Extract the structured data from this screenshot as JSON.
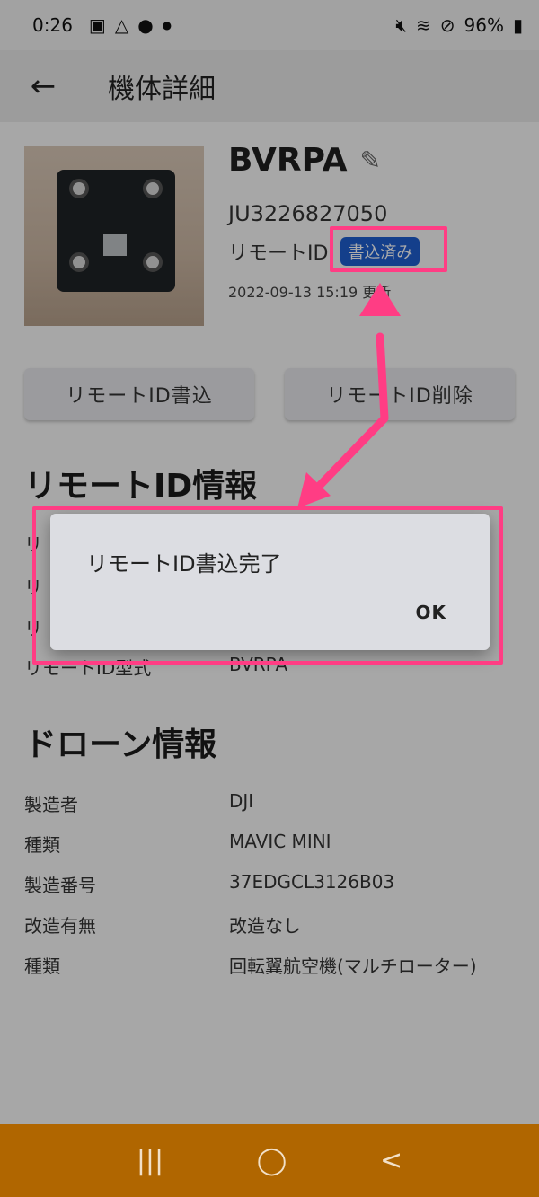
{
  "status_bar": {
    "time": "0:26",
    "battery": "96%",
    "icons_left": [
      "image-icon",
      "drive-icon",
      "account-icon",
      "dot-icon"
    ],
    "icons_right": [
      "mute-icon",
      "wifi-icon",
      "dnd-icon",
      "battery-icon"
    ]
  },
  "app_bar": {
    "title": "機体詳細",
    "back_icon": "arrow-left-icon"
  },
  "aircraft": {
    "name": "BVRPA",
    "serial": "JU3226827050",
    "remote_id_label": "リモートID",
    "remote_id_status": "書込済み",
    "updated": "2022-09-13 15:19 更新"
  },
  "buttons": {
    "write": "リモートID書込",
    "delete": "リモートID削除"
  },
  "remote_id_section": {
    "title": "リモートID情報",
    "rows": [
      {
        "key": "リモートID型式",
        "value": "BVRPA"
      }
    ]
  },
  "drone_section": {
    "title": "ドローン情報",
    "rows": [
      {
        "key": "製造者",
        "value": "DJI"
      },
      {
        "key": "種類",
        "value": "MAVIC MINI"
      },
      {
        "key": "製造番号",
        "value": "37EDGCL3126B03"
      },
      {
        "key": "改造有無",
        "value": "改造なし"
      },
      {
        "key": "種類",
        "value": "回転翼航空機(マルチローター)"
      }
    ]
  },
  "dialog": {
    "message": "リモートID書込完了",
    "ok_label": "OK"
  },
  "colors": {
    "highlight": "#ff3d84",
    "badge": "#1f5fd0",
    "nav_bar": "#b06600"
  }
}
